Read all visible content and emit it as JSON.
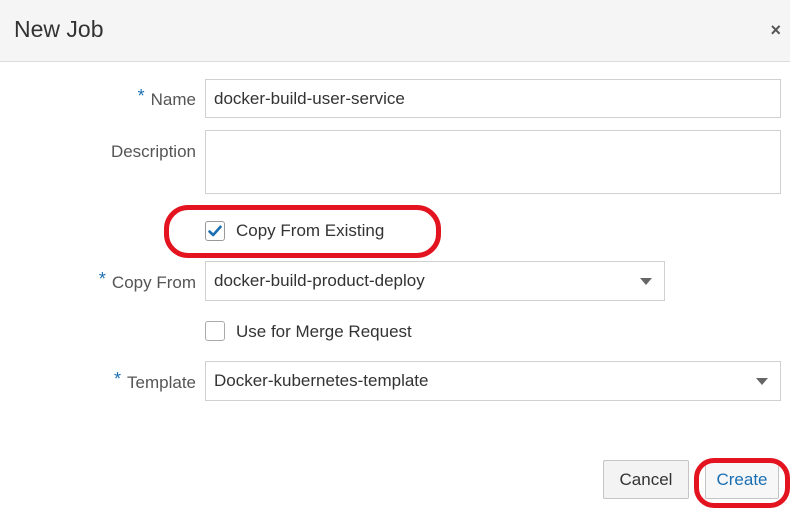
{
  "dialog": {
    "title": "New Job",
    "close_symbol": "×"
  },
  "form": {
    "required_marker": "*",
    "name": {
      "label": "Name",
      "value": "docker-build-user-service"
    },
    "description": {
      "label": "Description",
      "value": ""
    },
    "copy_from_existing": {
      "label": "Copy From Existing",
      "checked": true
    },
    "copy_from": {
      "label": "Copy From",
      "selected": "docker-build-product-deploy"
    },
    "use_for_merge_request": {
      "label": "Use for Merge Request",
      "checked": false
    },
    "template": {
      "label": "Template",
      "selected": "Docker-kubernetes-template"
    }
  },
  "footer": {
    "cancel_label": "Cancel",
    "create_label": "Create"
  },
  "colors": {
    "accent": "#1a6fb3",
    "highlight": "#e3141f",
    "header_bg": "#f5f5f5"
  },
  "icons": {
    "close": "close-icon",
    "checkmark": "checkmark-icon",
    "dropdown": "chevron-down-icon"
  }
}
